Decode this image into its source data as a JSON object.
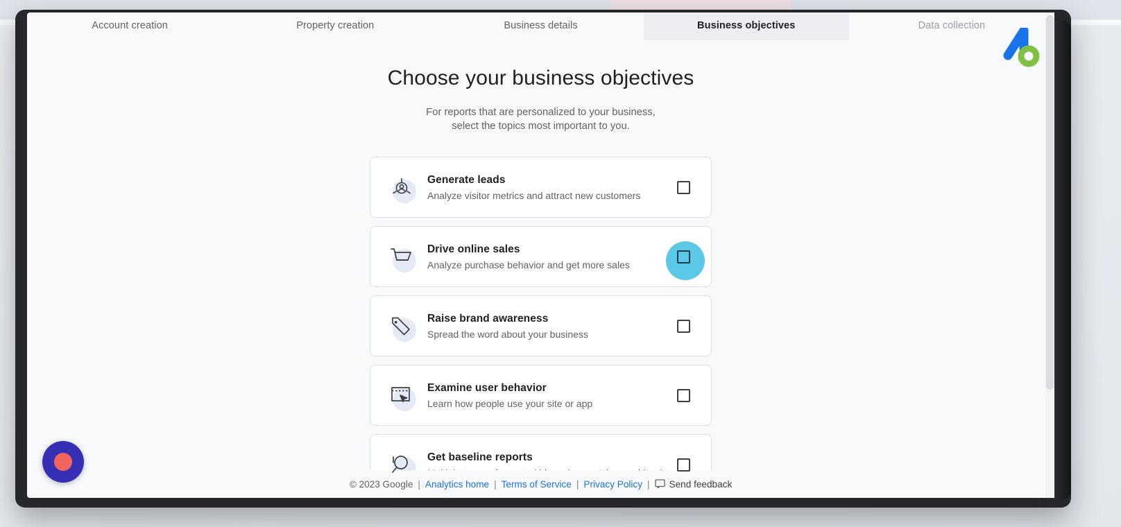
{
  "app": {
    "logo_name": "google-analytics-logo",
    "logo_colors": {
      "blue": "#1a73e8",
      "green": "#80c143"
    }
  },
  "stepper": {
    "steps": [
      {
        "label": "Account creation",
        "state": "done"
      },
      {
        "label": "Property creation",
        "state": "done"
      },
      {
        "label": "Business details",
        "state": "done"
      },
      {
        "label": "Business objectives",
        "state": "active"
      },
      {
        "label": "Data collection",
        "state": "upcoming"
      }
    ]
  },
  "main": {
    "title": "Choose your business objectives",
    "subtitle_line1": "For reports that are personalized to your business,",
    "subtitle_line2": "select the topics most important to you.",
    "options": [
      {
        "icon": "leads-target-icon",
        "title": "Generate leads",
        "description": "Analyze visitor metrics and attract new customers",
        "checked": false,
        "highlighted": false
      },
      {
        "icon": "shopping-cart-icon",
        "title": "Drive online sales",
        "description": "Analyze purchase behavior and get more sales",
        "checked": false,
        "highlighted": true
      },
      {
        "icon": "price-tag-icon",
        "title": "Raise brand awareness",
        "description": "Spread the word about your business",
        "checked": false,
        "highlighted": false
      },
      {
        "icon": "browser-cursor-icon",
        "title": "Examine user behavior",
        "description": "Learn how people use your site or app",
        "checked": false,
        "highlighted": false
      },
      {
        "icon": "magnifier-icon",
        "title": "Get baseline reports",
        "description": "Multiple types of reports (this option can't be combined",
        "checked": false,
        "highlighted": false
      }
    ]
  },
  "footer": {
    "copyright": "© 2023 Google",
    "sep": "|",
    "analytics_home": "Analytics home",
    "terms": "Terms of Service",
    "privacy": "Privacy Policy",
    "feedback": "Send feedback",
    "feedback_icon": "feedback-icon",
    "link_color": "#1a73e8"
  },
  "overlay": {
    "recording_indicator": "recording-indicator",
    "recording_outer_color": "#3730b5",
    "recording_dot_color": "#f4645f"
  },
  "scrollbar": {
    "name": "vertical-scrollbar",
    "thumb_color": "#dadce0"
  },
  "highlight": {
    "ripple_color": "#5bc8e8"
  }
}
